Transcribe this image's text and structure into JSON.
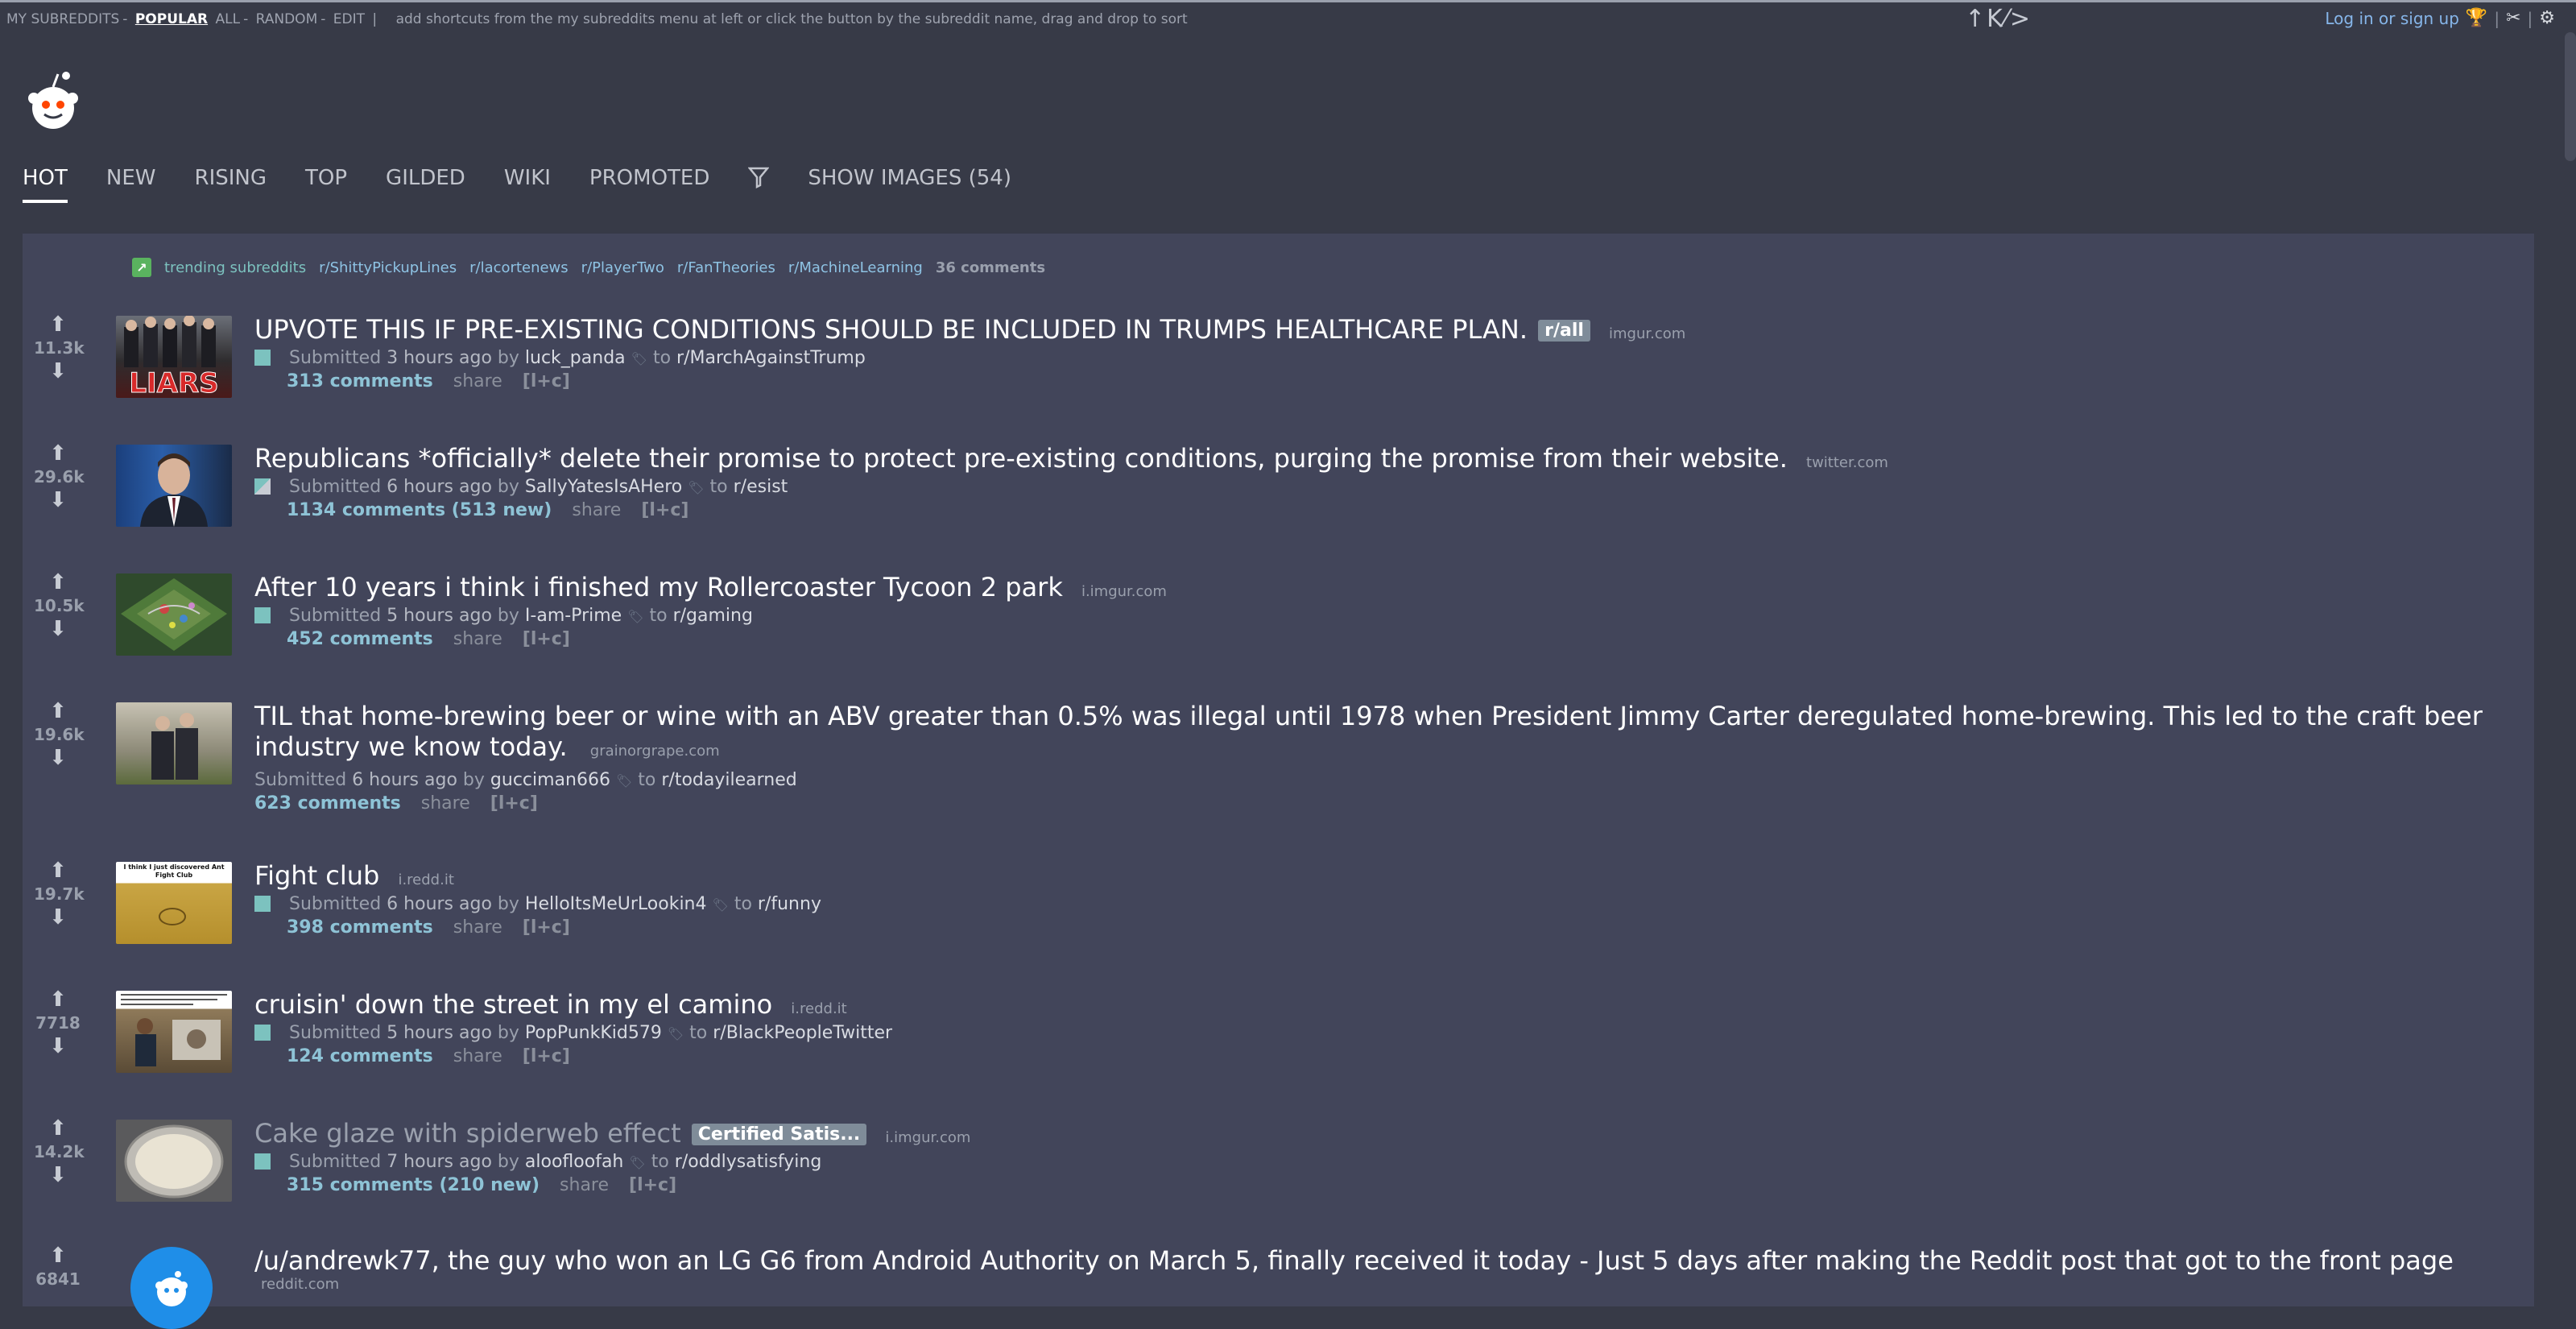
{
  "srbar": {
    "my_subreddits": "MY SUBREDDITS",
    "dash": "-",
    "popular": "POPULAR",
    "all": "ALL",
    "random": "RANDOM",
    "edit": "EDIT",
    "pipe": "|",
    "hint": "add shortcuts from the my subreddits menu at left or click the button by the subreddit name, drag and drop to sort",
    "sep": "-"
  },
  "arrows": "↑K⁄>",
  "login": {
    "text": "Log in or sign up"
  },
  "tabs": {
    "hot": "HOT",
    "new": "NEW",
    "rising": "RISING",
    "top": "TOP",
    "gilded": "GILDED",
    "wiki": "WIKI",
    "promoted": "PROMOTED",
    "show_images": "SHOW IMAGES (54)"
  },
  "trending": {
    "label": "trending subreddits",
    "subs": [
      "r/ShittyPickupLines",
      "r/lacortenews",
      "r/PlayerTwo",
      "r/FanTheories",
      "r/MachineLearning"
    ],
    "comments": "36 comments"
  },
  "posts": [
    {
      "score": "11.3k",
      "title": "UPVOTE THIS IF PRE-EXISTING CONDITIONS SHOULD BE INCLUDED IN TRUMPS HEALTHCARE PLAN.",
      "flair": "r/all",
      "domain": "imgur.com",
      "submitted": "Submitted",
      "time": "3 hours ago",
      "by": "by",
      "author": "luck_panda",
      "to": "to",
      "subreddit": "r/MarchAgainstTrump",
      "comments": "313 comments",
      "share": "share",
      "expand": "[l+c]",
      "thumb_text": "LIARS"
    },
    {
      "score": "29.6k",
      "title": "Republicans *officially* delete their promise to protect pre-existing conditions, purging the promise from their website.",
      "domain": "twitter.com",
      "submitted": "Submitted",
      "time": "6 hours ago",
      "by": "by",
      "author": "SallyYatesIsAHero",
      "to": "to",
      "subreddit": "r/esist",
      "comments": "1134 comments (513 new)",
      "share": "share",
      "expand": "[l+c]"
    },
    {
      "score": "10.5k",
      "title": "After 10 years i think i finished my Rollercoaster Tycoon 2 park",
      "domain": "i.imgur.com",
      "submitted": "Submitted",
      "time": "5 hours ago",
      "by": "by",
      "author": "I-am-Prime",
      "to": "to",
      "subreddit": "r/gaming",
      "comments": "452 comments",
      "share": "share",
      "expand": "[l+c]"
    },
    {
      "score": "19.6k",
      "title": "TIL that home-brewing beer or wine with an ABV greater than 0.5% was illegal until 1978 when President Jimmy Carter deregulated home-brewing. This led to the craft beer industry we know today.",
      "domain": "grainorgrape.com",
      "submitted": "Submitted",
      "time": "6 hours ago",
      "by": "by",
      "author": "gucciman666",
      "to": "to",
      "subreddit": "r/todayilearned",
      "comments": "623 comments",
      "share": "share",
      "expand": "[l+c]"
    },
    {
      "score": "19.7k",
      "title": "Fight club",
      "domain": "i.redd.it",
      "submitted": "Submitted",
      "time": "6 hours ago",
      "by": "by",
      "author": "HelloItsMeUrLookin4",
      "to": "to",
      "subreddit": "r/funny",
      "comments": "398 comments",
      "share": "share",
      "expand": "[l+c]",
      "thumb_text": "I think I just discovered Ant Fight Club"
    },
    {
      "score": "7718",
      "title": "cruisin' down the street in my el camino",
      "domain": "i.redd.it",
      "submitted": "Submitted",
      "time": "5 hours ago",
      "by": "by",
      "author": "PopPunkKid579",
      "to": "to",
      "subreddit": "r/BlackPeopleTwitter",
      "comments": "124 comments",
      "share": "share",
      "expand": "[l+c]"
    },
    {
      "score": "14.2k",
      "title": "Cake glaze with spiderweb effect",
      "flair": "Certified Satis...",
      "domain": "i.imgur.com",
      "submitted": "Submitted",
      "time": "7 hours ago",
      "by": "by",
      "author": "aloofloofah",
      "to": "to",
      "subreddit": "r/oddlysatisfying",
      "comments": "315 comments (210 new)",
      "share": "share",
      "expand": "[l+c]"
    },
    {
      "score": "6841",
      "title": "/u/andrewk77, the guy who won an LG G6 from Android Authority on March 5, finally received it today - Just 5 days after making the Reddit post that got to the front page",
      "domain": "reddit.com"
    }
  ],
  "colors": {
    "background": "#373a47",
    "panel": "#42455a",
    "link": "#86b6ea",
    "comments": "#8ec3d6"
  }
}
